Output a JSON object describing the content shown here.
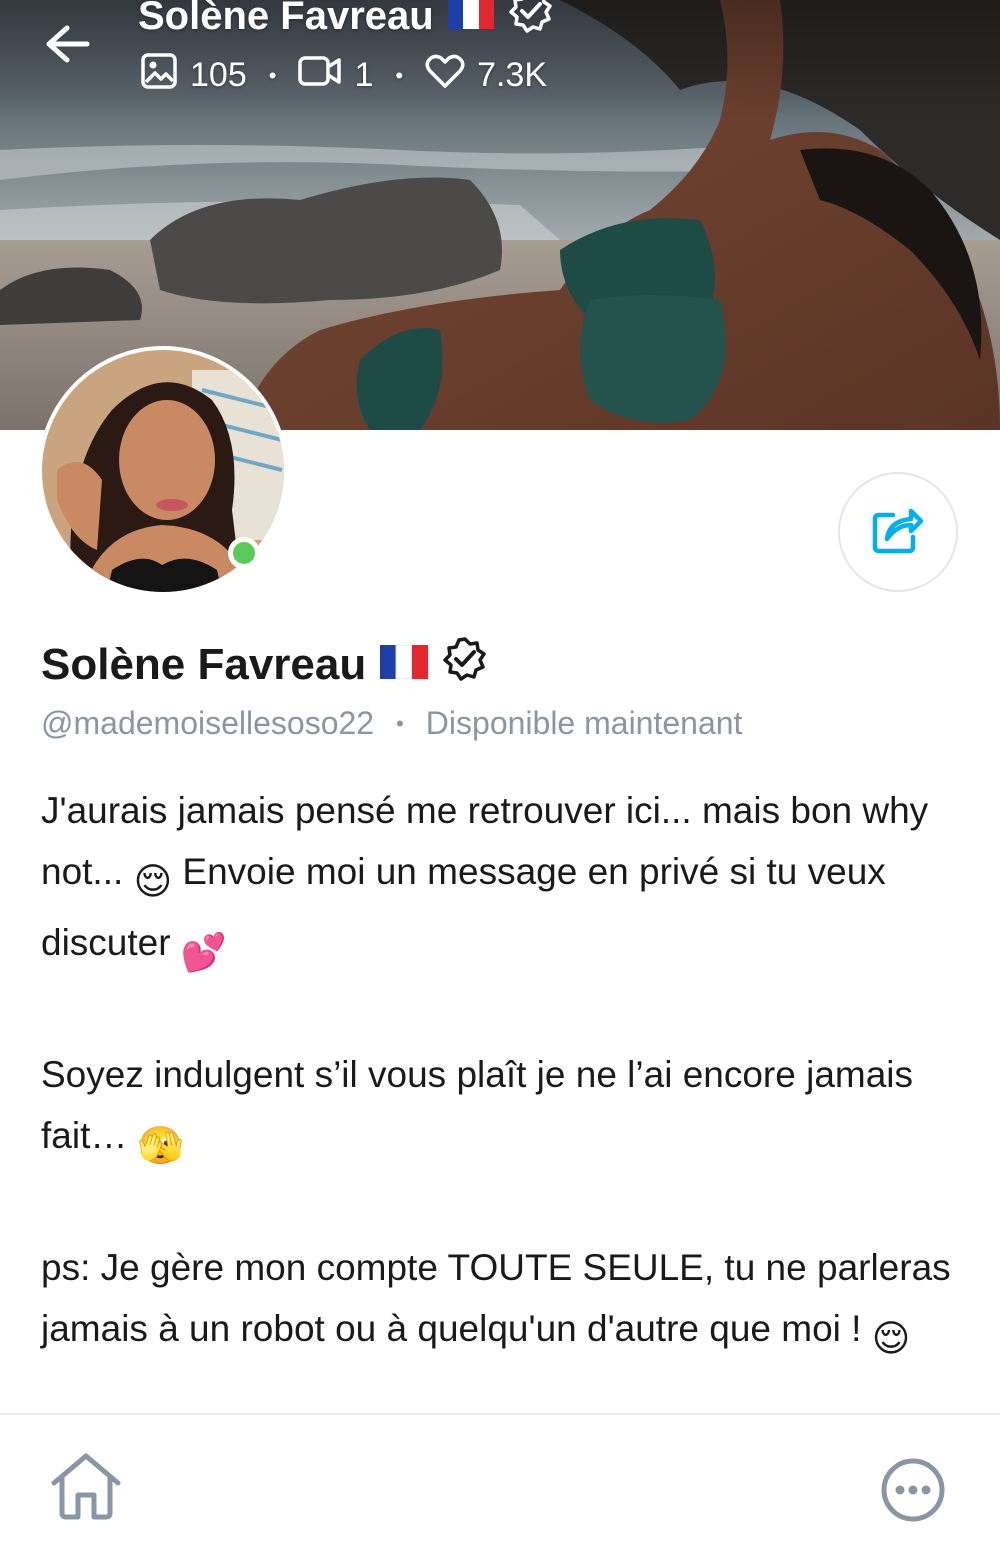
{
  "header": {
    "display_name": "Solène Favreau",
    "stats": {
      "photos": "105",
      "videos": "1",
      "likes": "7.3K"
    }
  },
  "profile": {
    "display_name": "Solène Favreau",
    "flag": "🇫🇷",
    "handle": "@mademoisellesoso22",
    "separator": "•",
    "status": "Disponible maintenant",
    "online": true
  },
  "bio": {
    "paragraph_1_text": "J'aurais jamais pensé me retrouver ici... mais bon why not... ",
    "paragraph_1_emoji": "😌",
    "paragraph_1_text_b": " Envoie moi un message en privé si tu veux discuter ",
    "paragraph_1_emoji_b": "💕",
    "paragraph_2_text": "Soyez indulgent s’il vous plaît je ne l’ai encore jamais fait… ",
    "paragraph_2_emoji": "🫣",
    "paragraph_3_text": "ps: Je gère mon compte TOUTE SEULE, tu ne parleras jamais à un robot ou à quelqu'un d'autre que moi ! ",
    "paragraph_3_emoji": "😌"
  },
  "icons": {
    "back": "arrow-left-icon",
    "photos": "image-icon",
    "videos": "video-icon",
    "likes": "heart-icon",
    "verified": "verified-badge-icon",
    "share": "share-icon",
    "home": "home-icon",
    "more": "more-icon"
  },
  "colors": {
    "accent": "#00aff0",
    "online": "#5ac85a",
    "muted_text": "#8a96a3"
  }
}
